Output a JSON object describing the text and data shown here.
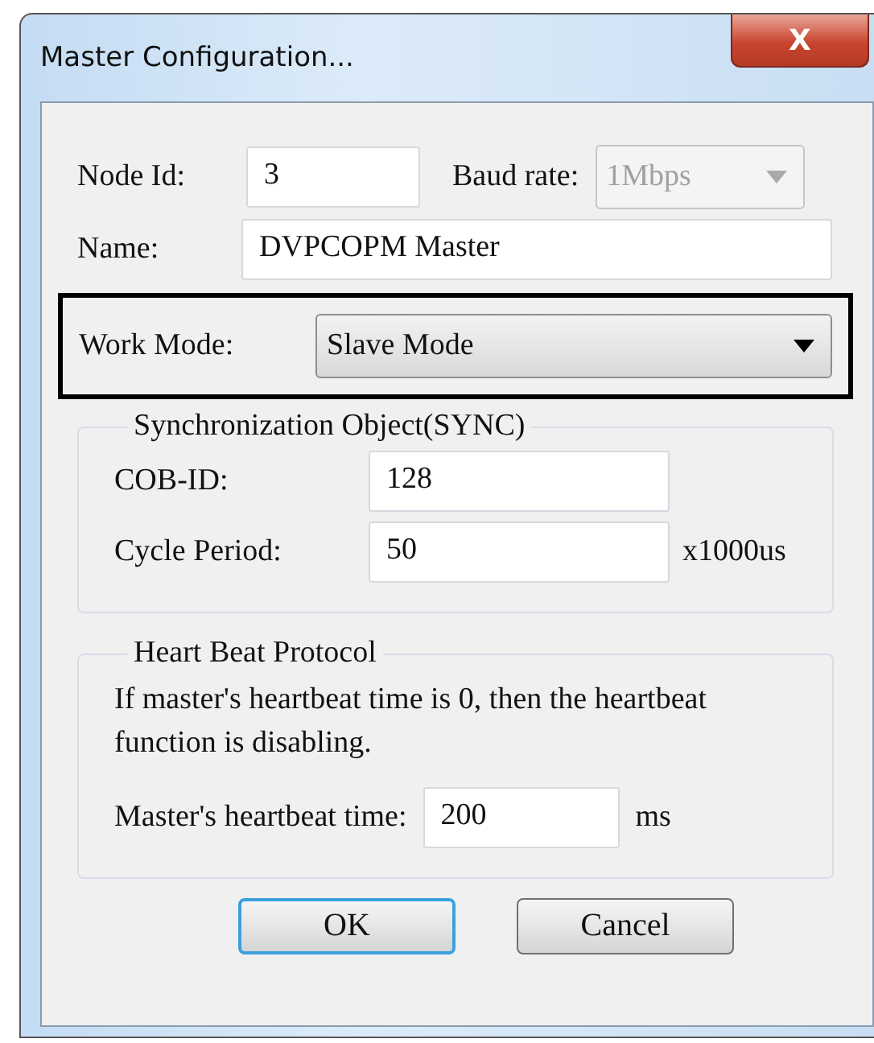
{
  "window": {
    "title": "Master Configuration...",
    "close": "X"
  },
  "node_id": {
    "label": "Node Id:",
    "value": "3"
  },
  "baud_rate": {
    "label": "Baud rate:",
    "value": "1Mbps",
    "disabled": true
  },
  "name": {
    "label": "Name:",
    "value": "DVPCOPM Master"
  },
  "work_mode": {
    "label": "Work Mode:",
    "value": "Slave Mode",
    "highlighted": true
  },
  "sync": {
    "title": "Synchronization Object(SYNC)",
    "fields": [
      {
        "label": "COB-ID:",
        "value": "128"
      },
      {
        "label": "Cycle Period:",
        "value": "50",
        "unit": "x1000us"
      }
    ]
  },
  "heartbeat": {
    "title": "Heart Beat Protocol",
    "note": "If master's heartbeat time is 0, then the heartbeat function is disabling.",
    "label": "Master's heartbeat time:",
    "value": "200",
    "unit": "ms"
  },
  "buttons": [
    {
      "label": "OK",
      "default": true
    },
    {
      "label": "Cancel",
      "default": false
    }
  ]
}
